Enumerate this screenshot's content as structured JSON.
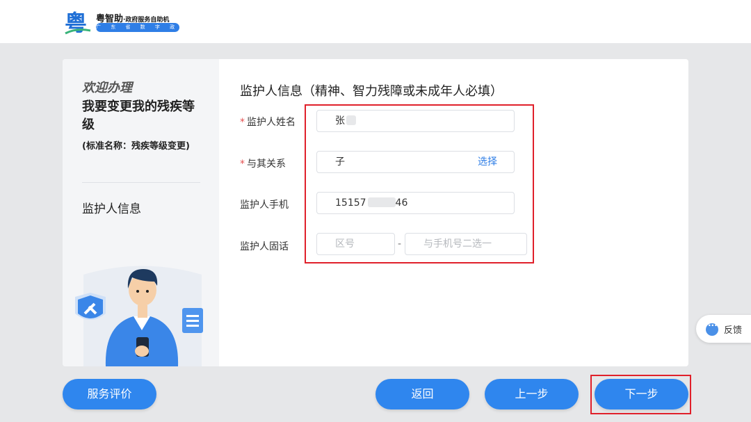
{
  "header": {
    "brand_name": "粤智助",
    "brand_sub": "·政府服务自助机",
    "brand_tag": "广 东 省 数 字 政 府",
    "brand_glyph": "粤"
  },
  "sidebar": {
    "welcome": "欢迎办理",
    "service_name": "我要变更我的残疾等级",
    "standard_name": "(标准名称：残疾等级变更)",
    "section": "监护人信息"
  },
  "form": {
    "title": "监护人信息（精神、智力残障或未成年人必填）",
    "name_label": "监护人姓名",
    "name_value": "张",
    "relation_label": "与其关系",
    "relation_value": "子",
    "relation_action": "选择",
    "phone_label": "监护人手机",
    "phone_prefix": "15157",
    "phone_suffix": "46",
    "landline_label": "监护人固话",
    "area_placeholder": "区号",
    "landline_placeholder": "与手机号二选一",
    "required_mark": "*",
    "dash": "-"
  },
  "footer": {
    "rate": "服务评价",
    "back": "返回",
    "prev": "上一步",
    "next": "下一步"
  },
  "feedback": {
    "label": "反馈"
  },
  "colors": {
    "accent": "#2f86ee",
    "highlight": "#e0202a",
    "background": "#e6e7e9"
  }
}
